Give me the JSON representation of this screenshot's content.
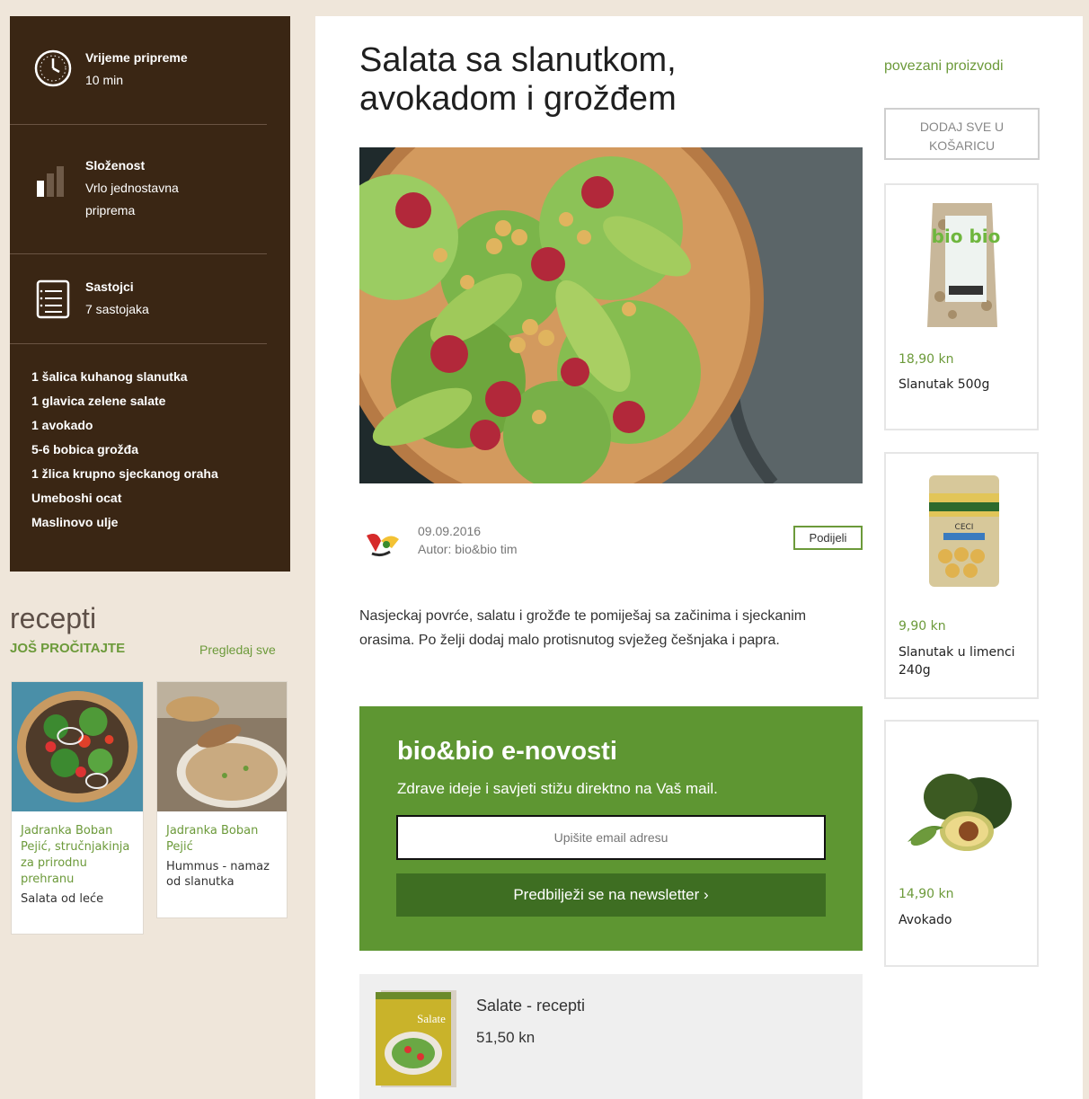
{
  "info": {
    "prep_label": "Vrijeme pripreme",
    "prep_value": "10 min",
    "difficulty_label": "Složenost",
    "difficulty_value_1": "Vrlo jednostavna",
    "difficulty_value_2": "priprema",
    "ingredients_label": "Sastojci",
    "ingredients_value": "7 sastojaka"
  },
  "ingredients": [
    "1 šalica kuhanog slanutka",
    "1 glavica zelene salate",
    "1 avokado",
    "5-6 bobica grožđa",
    "1 žlica krupno sjeckanog oraha",
    "Umeboshi ocat",
    "Maslinovo ulje"
  ],
  "recepti": {
    "title": "recepti",
    "subtitle": "JOŠ PROČITAJTE",
    "view_all": "Pregledaj sve",
    "cards": [
      {
        "author": "Jadranka Boban Pejić, stručnjakinja za prirodnu prehranu",
        "name": "Salata od leće"
      },
      {
        "author": "Jadranka Boban Pejić",
        "name": "Hummus - namaz od slanutka"
      }
    ]
  },
  "article": {
    "title": "Salata sa slanutkom, avokadom i grožđem",
    "date": "09.09.2016",
    "author": "Autor: bio&bio tim",
    "share": "Podijeli",
    "description": "Nasjeckaj povrće, salatu i grožđe te pomiješaj sa začinima i sjeckanim orasima. Po želji dodaj malo protisnutog svježeg češnjaka i papra."
  },
  "newsletter": {
    "title": "bio&bio e-novosti",
    "subtitle": "Zdrave ideje i savjeti stižu direktno na Vaš mail.",
    "placeholder": "Upišite email adresu",
    "button": "Predbilježi se na newsletter ›"
  },
  "book": {
    "title": "Salate - recepti",
    "price": "51,50 kn",
    "cover_text": "Salate"
  },
  "products": {
    "heading": "povezani proizvodi",
    "add_all": "DODAJ SVE U KOŠARICU",
    "items": [
      {
        "price": "18,90 kn",
        "name": "Slanutak 500g",
        "label": "bio bio"
      },
      {
        "price": "9,90 kn",
        "name": "Slanutak u limenci 240g",
        "label": "CECI"
      },
      {
        "price": "14,90 kn",
        "name": "Avokado"
      }
    ]
  },
  "colors": {
    "panel_brown": "#3a2614",
    "accent_green": "#6c9a3a",
    "newsletter_green": "#5e9632"
  }
}
